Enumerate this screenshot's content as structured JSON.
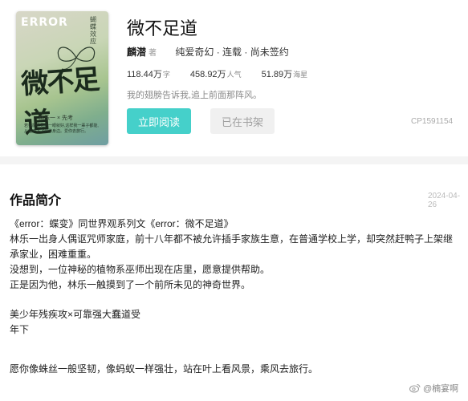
{
  "book": {
    "cover": {
      "error_word": "ERROR",
      "vertical_text": "蝴蝶效应",
      "big_title": "微不足道",
      "author_line": "林乐一 × 先考",
      "blurb": "若我能看见你一眼就好,这样我一辈子都能,从蓝天下飞到你身边。爱你去旅行。"
    },
    "title": "微不足道",
    "author": "麟潜",
    "author_suffix": "著",
    "tags": "纯爱奇幻 · 连载 · 尚未签约",
    "stats": [
      {
        "value": "118.44万",
        "unit": "字"
      },
      {
        "value": "458.92万",
        "unit": "人气"
      },
      {
        "value": "51.89万",
        "unit": "海星"
      }
    ],
    "slogan": "我的翅膀告诉我,追上前面那阵风。",
    "read_button": "立即阅读",
    "shelf_button": "已在书架",
    "book_id": "CP1591154"
  },
  "intro": {
    "heading": "作品简介",
    "date": "2024-04-26",
    "paragraphs": [
      "《error：蝶变》同世界观系列文《error：微不足道》",
      "林乐一出身人偶讴咒师家庭，前十八年都不被允许插手家族生意，在普通学校上学，却突然赶鸭子上架继承家业，困难重重。",
      "没想到，一位神秘的植物系巫师出现在店里，愿意提供帮助。",
      "正是因为他，林乐一触摸到了一个前所未见的神奇世界。",
      "",
      "美少年残疾攻×可靠强大蠢道受",
      "年下",
      "",
      "愿你像蛛丝一般坚韧，像蚂蚁一样强壮，站在叶上看风景，乘风去旅行。"
    ]
  },
  "watermark": {
    "text": "@楠宴啊"
  }
}
